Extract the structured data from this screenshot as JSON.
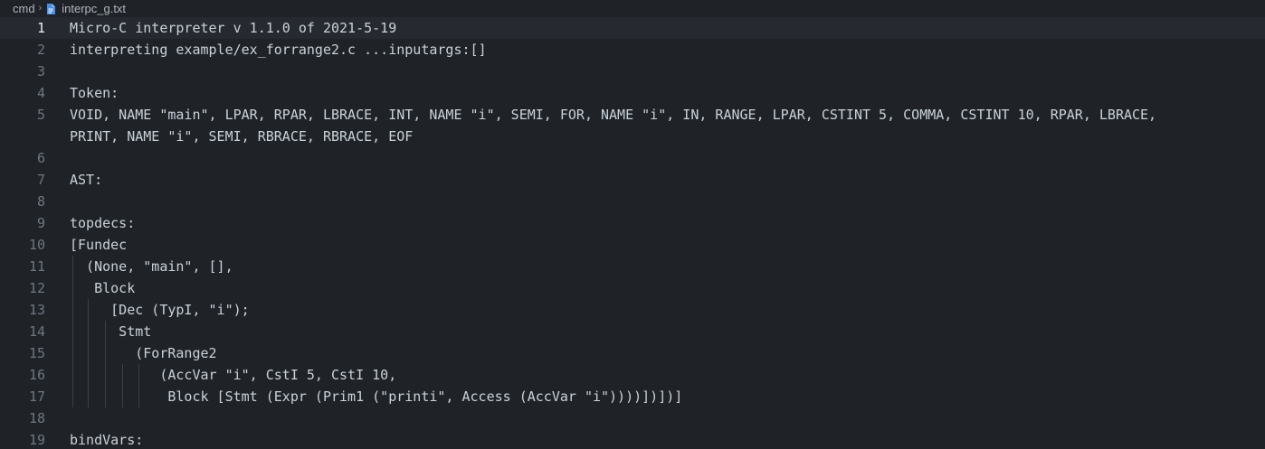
{
  "breadcrumb": {
    "folder": "cmd",
    "file": "interpc_g.txt"
  },
  "lines": [
    {
      "num": "1",
      "text": "Micro-C interpreter v 1.1.0 of 2021-5-19",
      "current": true,
      "guides": 0
    },
    {
      "num": "2",
      "text": "interpreting example/ex_forrange2.c ...inputargs:[]",
      "guides": 0
    },
    {
      "num": "3",
      "text": "",
      "guides": 0
    },
    {
      "num": "4",
      "text": "Token:",
      "guides": 0
    },
    {
      "num": "5",
      "text": "VOID, NAME \"main\", LPAR, RPAR, LBRACE, INT, NAME \"i\", SEMI, FOR, NAME \"i\", IN, RANGE, LPAR, CSTINT 5, COMMA, CSTINT 10, RPAR, LBRACE,",
      "guides": 0
    },
    {
      "num": "",
      "text": "PRINT, NAME \"i\", SEMI, RBRACE, RBRACE, EOF",
      "guides": 0
    },
    {
      "num": "6",
      "text": "",
      "guides": 0
    },
    {
      "num": "7",
      "text": "AST:",
      "guides": 0
    },
    {
      "num": "8",
      "text": "",
      "guides": 0
    },
    {
      "num": "9",
      "text": "topdecs:",
      "guides": 0
    },
    {
      "num": "10",
      "text": "[Fundec",
      "guides": 0
    },
    {
      "num": "11",
      "text": "  (None, \"main\", [],",
      "guides": 1
    },
    {
      "num": "12",
      "text": "   Block",
      "guides": 1
    },
    {
      "num": "13",
      "text": "     [Dec (TypI, \"i\");",
      "guides": 2
    },
    {
      "num": "14",
      "text": "      Stmt",
      "guides": 3
    },
    {
      "num": "15",
      "text": "        (ForRange2",
      "guides": 3
    },
    {
      "num": "16",
      "text": "           (AccVar \"i\", CstI 5, CstI 10,",
      "guides": 5
    },
    {
      "num": "17",
      "text": "            Block [Stmt (Expr (Prim1 (\"printi\", Access (AccVar \"i\"))))])])]",
      "guides": 5
    },
    {
      "num": "18",
      "text": "",
      "guides": 0
    },
    {
      "num": "19",
      "text": "bindVars:",
      "guides": 0
    }
  ]
}
